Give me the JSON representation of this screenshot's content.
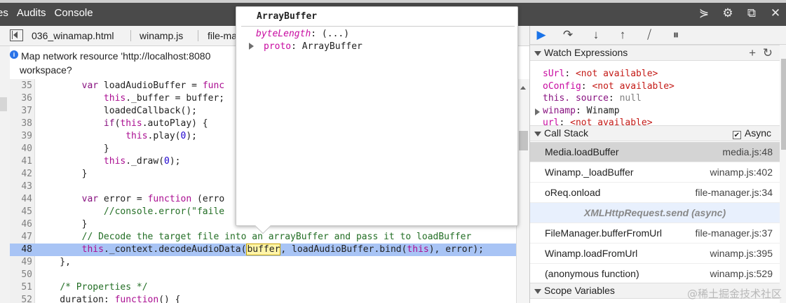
{
  "topbar": {
    "menus": [
      "es",
      "Audits",
      "Console"
    ],
    "icons": [
      "console-toggle-icon",
      "gear-icon",
      "dock-icon",
      "close-icon"
    ]
  },
  "tabs": [
    "036_winamap.html",
    "winamp.js",
    "file-ma"
  ],
  "info": {
    "line1": "Map network resource 'http://localhost:8080",
    "line2": "workspace?"
  },
  "code": {
    "lines": [
      {
        "n": "35",
        "html": "        <span class=\"kw2\">var</span> loadAudioBuffer = <span class=\"kw\">func</span>"
      },
      {
        "n": "36",
        "html": "            <span class=\"kw\">this</span>._buffer = buffer;"
      },
      {
        "n": "37",
        "html": "            loadedCallback();"
      },
      {
        "n": "38",
        "html": "            <span class=\"kw2\">if</span>(<span class=\"kw\">this</span>.autoPlay) {"
      },
      {
        "n": "39",
        "html": "                <span class=\"kw\">this</span>.play(<span class=\"num-lit\">0</span>);"
      },
      {
        "n": "40",
        "html": "            }"
      },
      {
        "n": "41",
        "html": "            <span class=\"kw\">this</span>._draw(<span class=\"num-lit\">0</span>);"
      },
      {
        "n": "42",
        "html": "        }"
      },
      {
        "n": "43",
        "html": ""
      },
      {
        "n": "44",
        "html": "        <span class=\"kw2\">var</span> error = <span class=\"kw\">function</span> (erro"
      },
      {
        "n": "45",
        "html": "            <span class=\"cm\">//console.error(\"faile</span>"
      },
      {
        "n": "46",
        "html": "        }"
      },
      {
        "n": "47",
        "html": "        <span class=\"cm\">// Decode the target file into an arrayBuffer and pass it to loadBuffer</span>"
      },
      {
        "n": "48",
        "html": "        <span class=\"kw\">this</span>._context.decodeAudioData(<span class=\"tok-hl\">buffer</span>, loadAudioBuffer.bind(<span class=\"kw\">this</span>), error);",
        "hl": true
      },
      {
        "n": "49",
        "html": "    },"
      },
      {
        "n": "50",
        "html": ""
      },
      {
        "n": "51",
        "html": "    <span class=\"cm\">/* Properties */</span>"
      },
      {
        "n": "52",
        "html": "    duration: <span class=\"kw\">function</span>() {"
      }
    ]
  },
  "popover": {
    "title": "ArrayBuffer",
    "prop1_name": "byteLength",
    "prop1_value": ": (...)",
    "prop2_name": "proto",
    "prop2_value": ": ArrayBuffer"
  },
  "debugger": {
    "watch_title": "Watch Expressions",
    "watch": [
      {
        "key": "sUrl",
        "val": "<not available>",
        "kind": "na"
      },
      {
        "key": "oConfig",
        "val": "<not available>",
        "kind": "na"
      },
      {
        "key": "this. source",
        "val": "null",
        "kind": "null"
      },
      {
        "key": "winamp",
        "val": "Winamp",
        "kind": "obj"
      },
      {
        "key": "url",
        "val": "<not available>",
        "kind": "na"
      }
    ],
    "callstack_title": "Call Stack",
    "async_label": "Async",
    "stack": [
      {
        "fn": "Media.loadBuffer",
        "loc": "media.js:48",
        "sel": true
      },
      {
        "fn": "Winamp._loadBuffer",
        "loc": "winamp.js:402"
      },
      {
        "fn": "oReq.onload",
        "loc": "file-manager.js:34"
      },
      {
        "fn": "XMLHttpRequest.send (async)",
        "loc": "",
        "async": true
      },
      {
        "fn": "FileManager.bufferFromUrl",
        "loc": "file-manager.js:37"
      },
      {
        "fn": "Winamp.loadFromUrl",
        "loc": "winamp.js:395"
      },
      {
        "fn": "(anonymous function)",
        "loc": "winamp.js:529"
      }
    ],
    "scope_title": "Scope Variables"
  },
  "watermark": "@稀土掘金技术社区"
}
